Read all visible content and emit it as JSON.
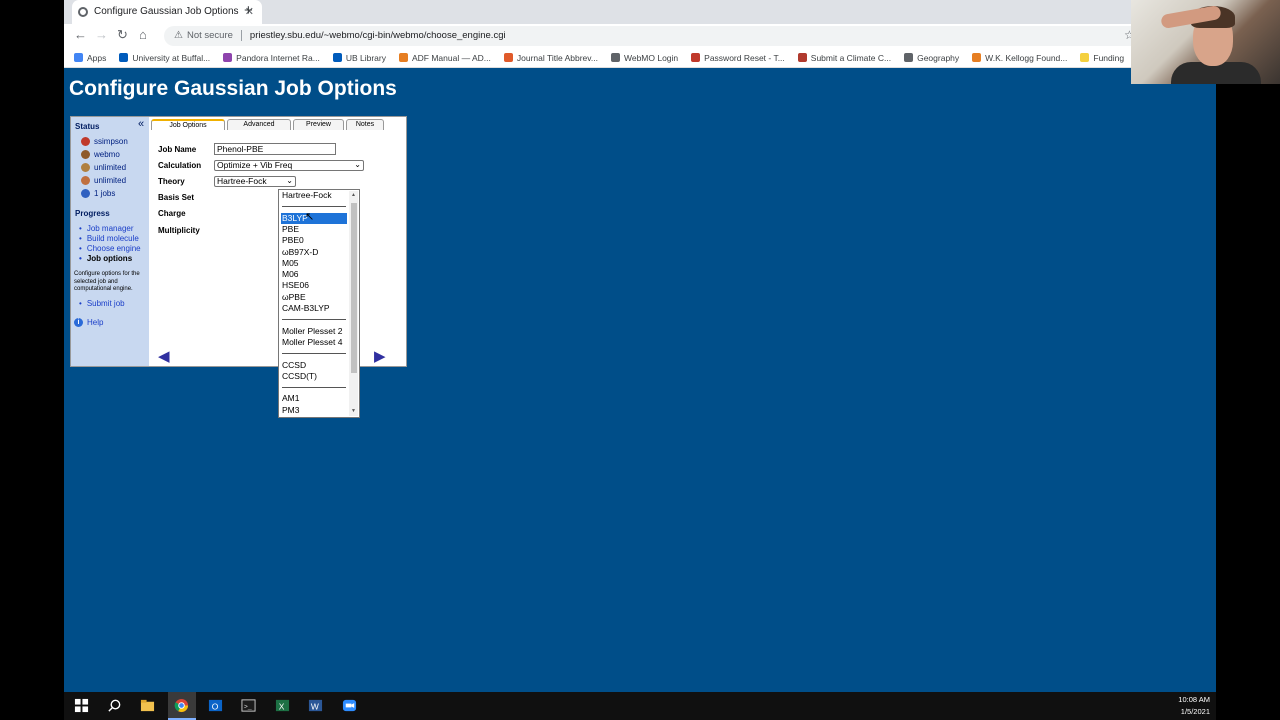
{
  "browser": {
    "tab_title": "Configure Gaussian Job Options",
    "tab_close": "✕",
    "new_tab": "+",
    "security_label": "Not secure",
    "url": "priestley.sbu.edu/~webmo/cgi-bin/webmo/choose_engine.cgi",
    "bookmarks": [
      {
        "label": "Apps",
        "color": "#4285f4"
      },
      {
        "label": "University at Buffal...",
        "color": "#005bbb"
      },
      {
        "label": "Pandora Internet Ra...",
        "color": "#8e44ad"
      },
      {
        "label": "UB Library",
        "color": "#005bbb"
      },
      {
        "label": "ADF Manual — AD...",
        "color": "#e67e22"
      },
      {
        "label": "Journal Title Abbrev...",
        "color": "#e05a2a"
      },
      {
        "label": "WebMO Login",
        "color": "#5f6368"
      },
      {
        "label": "Password Reset - T...",
        "color": "#c0392b"
      },
      {
        "label": "Submit a Climate C...",
        "color": "#b03a2e"
      },
      {
        "label": "Geography",
        "color": "#5f6368"
      },
      {
        "label": "W.K. Kellogg Found...",
        "color": "#e67e22"
      },
      {
        "label": "Funding",
        "color": "#f4d03f"
      }
    ]
  },
  "page": {
    "title": "Configure Gaussian Job Options",
    "sidebar": {
      "status_header": "Status",
      "collapse_glyph": "«",
      "status_items": [
        {
          "label": "ssimpson",
          "color": "#c0392b"
        },
        {
          "label": "webmo",
          "color": "#8e5a2b"
        },
        {
          "label": "unlimited",
          "color": "#b08040"
        },
        {
          "label": "unlimited",
          "color": "#c07040"
        },
        {
          "label": "1 jobs",
          "color": "#3060c0"
        }
      ],
      "progress_header": "Progress",
      "progress_items": [
        "Job manager",
        "Build molecule",
        "Choose engine",
        "Job options"
      ],
      "description": "Configure options for the selected job and computational engine.",
      "submit": "Submit job",
      "help": "Help",
      "help_icon": "i"
    },
    "tabs": [
      "Job Options",
      "Advanced",
      "Preview",
      "Notes"
    ],
    "form": {
      "job_name_label": "Job Name",
      "job_name_value": "Phenol-PBE",
      "calculation_label": "Calculation",
      "calculation_value": "Optimize + Vib Freq",
      "theory_label": "Theory",
      "theory_value": "Hartree-Fock",
      "basis_label": "Basis Set",
      "charge_label": "Charge",
      "multiplicity_label": "Multiplicity",
      "select_arrow": "⌄"
    },
    "nav": {
      "back": "◀",
      "next": "▶"
    },
    "theory_dropdown": {
      "groups": [
        [
          "Hartree-Fock"
        ],
        [
          "B3LYP",
          "PBE",
          "PBE0",
          "ωB97X-D",
          "M05",
          "M06",
          "HSE06",
          "ωPBE",
          "CAM-B3LYP"
        ],
        [
          "Moller Plesset 2",
          "Moller Plesset 4"
        ],
        [
          "CCSD",
          "CCSD(T)"
        ],
        [
          "AM1",
          "PM3"
        ]
      ],
      "highlighted": "B3LYP"
    }
  },
  "taskbar": {
    "time": "10:08 AM",
    "date": "1/5/2021"
  }
}
